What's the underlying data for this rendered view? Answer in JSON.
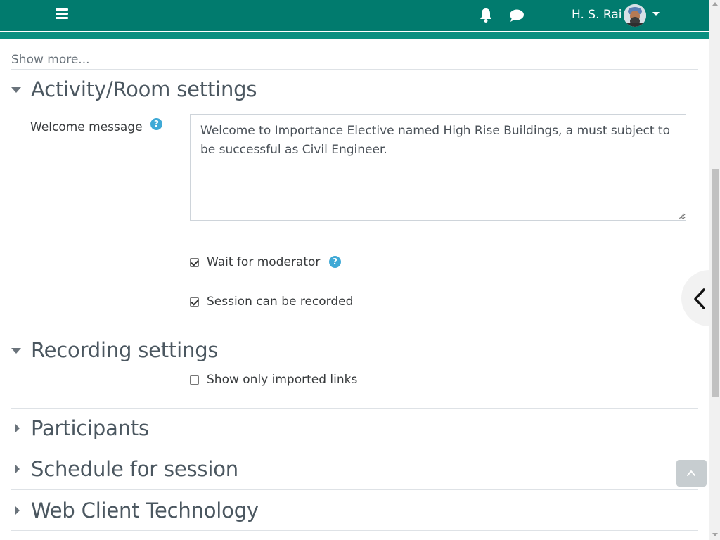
{
  "navbar": {
    "username": "H. S. Rai",
    "icons": [
      "menu-icon",
      "bell-icon",
      "chat-icon",
      "user-menu-caret-icon"
    ]
  },
  "show_more": "Show more...",
  "sections": {
    "activity_room": {
      "title": "Activity/Room settings",
      "welcome_label": "Welcome message",
      "welcome_value": "Welcome to Importance Elective named High Rise Buildings, a must subject to be successful as Civil Engineer.",
      "wait_for_moderator": {
        "label": "Wait for moderator",
        "checked": true
      },
      "session_recorded": {
        "label": "Session can be recorded",
        "checked": true
      }
    },
    "recording": {
      "title": "Recording settings",
      "imported_links": {
        "label": "Show only imported links",
        "checked": false
      }
    },
    "participants": {
      "title": "Participants"
    },
    "schedule": {
      "title": "Schedule for session"
    },
    "web_client": {
      "title": "Web Client Technology"
    }
  },
  "colors": {
    "navbar": "#017b6e",
    "help_icon": "#3fa9d6",
    "section_title": "#4b5760"
  }
}
